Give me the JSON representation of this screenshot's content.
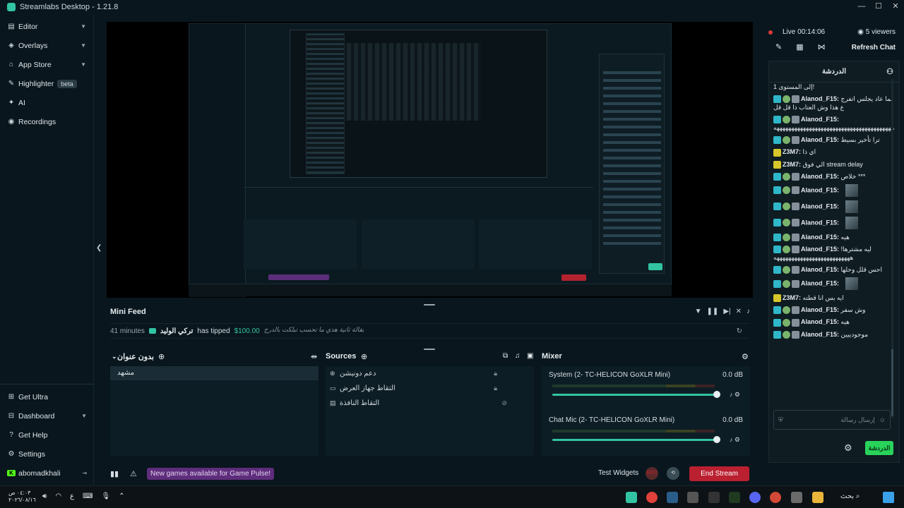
{
  "app": {
    "title": "Streamlabs Desktop - 1.21.8"
  },
  "sidebar": {
    "items": [
      {
        "label": "Editor",
        "icon": "editor-icon",
        "chevron": true
      },
      {
        "label": "Overlays",
        "icon": "overlays-icon",
        "chevron": true
      },
      {
        "label": "App Store",
        "icon": "app-store-icon",
        "chevron": true
      },
      {
        "label": "Highlighter",
        "icon": "highlighter-icon",
        "chevron": false,
        "badge": "beta"
      },
      {
        "label": "AI",
        "icon": "ai-icon",
        "chevron": false
      },
      {
        "label": "Recordings",
        "icon": "recordings-icon",
        "chevron": false
      }
    ],
    "bottom": [
      {
        "label": "Get Ultra",
        "icon": "ultra-icon"
      },
      {
        "label": "Dashboard",
        "icon": "dashboard-icon",
        "chevron": true
      },
      {
        "label": "Get Help",
        "icon": "help-icon"
      },
      {
        "label": "Settings",
        "icon": "gear-icon"
      },
      {
        "label": "abomadkhali",
        "icon": "kick-icon"
      }
    ]
  },
  "minifeed": {
    "title": "Mini Feed",
    "time": "41 minutes",
    "user": "تركي الوليد",
    "action": "has tipped",
    "amount": "$100.00",
    "message": "بقالة ثانية هذي ما تحسب تبلكت بالدرج"
  },
  "scenes": {
    "title": "بدون عنوان",
    "items": [
      "مشهد"
    ]
  },
  "sources": {
    "title": "Sources",
    "items": [
      {
        "label": "دعم دونيشن",
        "icon": "globe-icon"
      },
      {
        "label": "التقاط جهاز العرض",
        "icon": "monitor-icon"
      },
      {
        "label": "التقاط النافذة",
        "icon": "window-icon"
      }
    ]
  },
  "mixer": {
    "title": "Mixer",
    "channels": [
      {
        "name": "System (2- TC-HELICON GoXLR Mini)",
        "db": "0.0 dB",
        "level": 1.0
      },
      {
        "name": "Chat Mic (2- TC-HELICON GoXLR Mini)",
        "db": "0.0 dB",
        "level": 1.0
      }
    ]
  },
  "footer": {
    "pulse": "New games available for Game Pulse!",
    "test_widgets": "Test Widgets",
    "end_stream": "End Stream"
  },
  "live": {
    "status": "Live",
    "time": "00:14:06",
    "viewers": "5 viewers",
    "refresh": "Refresh Chat"
  },
  "chat": {
    "header": "الدردشة",
    "placeholder": "إرسال رسالة",
    "button": "الدردشة",
    "messages": [
      {
        "user": "",
        "text": "إلى المستوى 1!",
        "badges": []
      },
      {
        "user": "Alanod_F15:",
        "text": "لما عاد يجلس اتفرج ع هذا وش العتاب ذا قل قل",
        "badges": [
          "t",
          "g",
          "s"
        ]
      },
      {
        "user": "Alanod_F15:",
        "text": "ههههههههههههههههههههههههههههههههههههههههه",
        "badges": [
          "t",
          "g",
          "s"
        ]
      },
      {
        "user": "Alanod_F15:",
        "text": "ترا تأخير بسيط",
        "badges": [
          "t",
          "g",
          "s"
        ]
      },
      {
        "user": "Z3M7:",
        "text": "اي ذا",
        "badges": [
          "y"
        ]
      },
      {
        "user": "Z3M7:",
        "text": "الي فوق stream delay",
        "badges": [
          "y"
        ]
      },
      {
        "user": "Alanod_F15:",
        "text": "خلاص ***",
        "badges": [
          "t",
          "g",
          "s"
        ]
      },
      {
        "user": "Alanod_F15:",
        "text": "",
        "badges": [
          "t",
          "g",
          "s"
        ],
        "thumb": true
      },
      {
        "user": "Alanod_F15:",
        "text": "",
        "badges": [
          "t",
          "g",
          "s"
        ],
        "thumb": true
      },
      {
        "user": "Alanod_F15:",
        "text": "",
        "badges": [
          "t",
          "g",
          "s"
        ],
        "thumb": true
      },
      {
        "user": "Alanod_F15:",
        "text": "هيه",
        "badges": [
          "t",
          "g",
          "s"
        ]
      },
      {
        "user": "Alanod_F15:",
        "text": "ليه مشترها! ههههههههههههههههههههههههههه",
        "badges": [
          "t",
          "g",
          "s"
        ]
      },
      {
        "user": "Alanod_F15:",
        "text": "احس قلل وحلها",
        "badges": [
          "t",
          "g",
          "s"
        ]
      },
      {
        "user": "Alanod_F15:",
        "text": "",
        "badges": [
          "t",
          "g",
          "s"
        ],
        "thumb": true
      },
      {
        "user": "Z3M7:",
        "text": "ايه بس انا قطته",
        "badges": [
          "y"
        ]
      },
      {
        "user": "Alanod_F15:",
        "text": "وش سفر",
        "badges": [
          "t",
          "g",
          "s"
        ]
      },
      {
        "user": "Alanod_F15:",
        "text": "هيه",
        "badges": [
          "t",
          "g",
          "s"
        ]
      },
      {
        "user": "Alanod_F15:",
        "text": "موجودييين",
        "badges": [
          "t",
          "g",
          "s"
        ]
      }
    ]
  },
  "taskbar": {
    "time": "٠٤:٠٣ ص",
    "date": "٢٠٢٦/٠٨/١٦",
    "lang": "ع",
    "search": "بحث"
  },
  "colors": {
    "accent": "#31c3a2",
    "end_stream": "#ba2030",
    "pulse": "#5e2d7c",
    "chat_button": "#29d35a"
  }
}
